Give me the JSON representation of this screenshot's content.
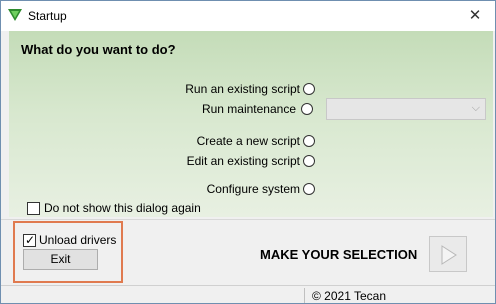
{
  "window": {
    "title": "Startup",
    "close_glyph": "✕"
  },
  "main": {
    "heading": "What do you want to do?",
    "options": [
      {
        "label": "Run an existing script"
      },
      {
        "label": "Run maintenance"
      },
      {
        "label": "Create a new script"
      },
      {
        "label": "Edit an existing script"
      },
      {
        "label": "Configure system"
      }
    ],
    "maintenance_dropdown": {
      "value": ""
    },
    "dont_show": {
      "label": "Do not show this dialog again",
      "checked": false
    }
  },
  "bottom": {
    "unload_drivers": {
      "label": "Unload drivers",
      "checked": true
    },
    "exit_label": "Exit",
    "make_selection": "MAKE YOUR SELECTION"
  },
  "status": {
    "copyright": "© 2021 Tecan"
  },
  "colors": {
    "highlight": "#e07a4f",
    "panel_top": "#c4dcb8",
    "panel_bottom": "#e8f0e2",
    "icon_green": "#2e8b2e"
  }
}
